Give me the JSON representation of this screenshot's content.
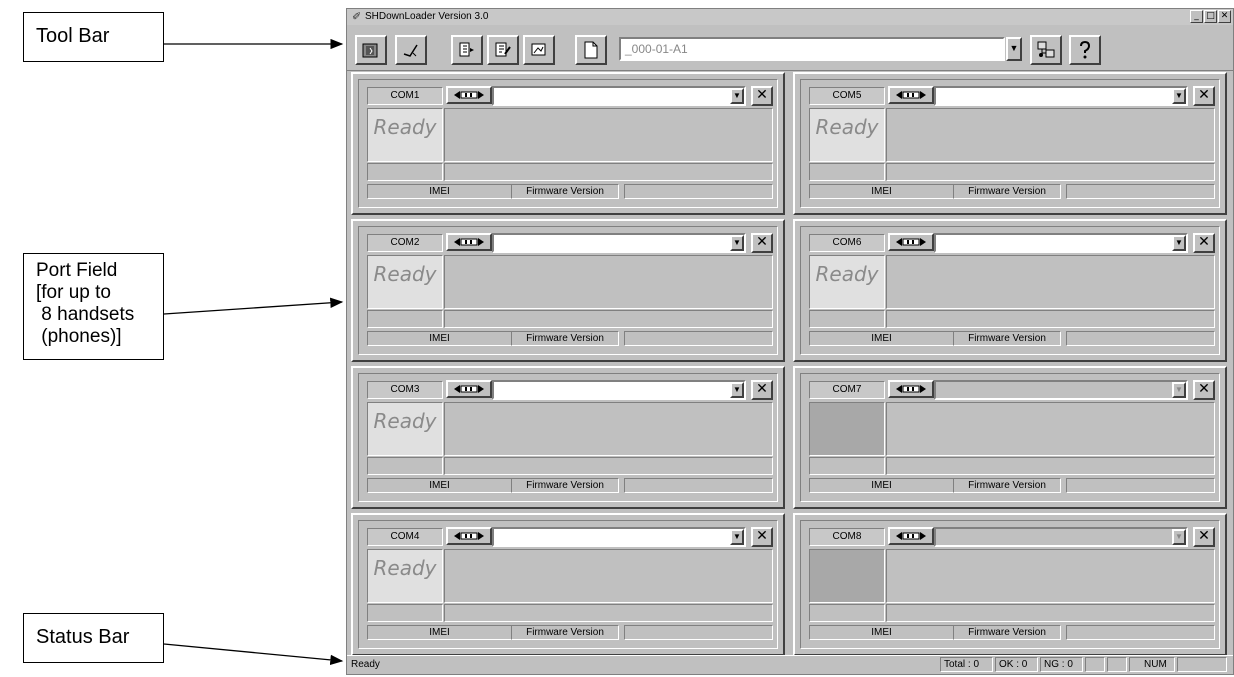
{
  "annotations": {
    "tool_bar": "Tool Bar",
    "port_field": [
      "Port Field",
      "[for up to",
      " 8 handsets",
      " (phones)]"
    ],
    "status_bar": "Status Bar"
  },
  "window": {
    "title": "SHDownLoader Version 3.0",
    "minimize": "_",
    "maximize": "□",
    "close": "✕"
  },
  "toolbar": {
    "file_path": "_000-01-A1",
    "tools": [
      "open-device-icon",
      "flash-check-icon",
      "import-icon",
      "edit-icon",
      "settings-icon",
      "new-file-icon"
    ],
    "right_tools": [
      "network-icon",
      "help-icon"
    ]
  },
  "ports": [
    {
      "name": "COM1",
      "status": "Ready",
      "imei_label": "IMEI",
      "fw_label": "Firmware Version",
      "enabled": true
    },
    {
      "name": "COM2",
      "status": "Ready",
      "imei_label": "IMEI",
      "fw_label": "Firmware Version",
      "enabled": true
    },
    {
      "name": "COM3",
      "status": "Ready",
      "imei_label": "IMEI",
      "fw_label": "Firmware Version",
      "enabled": true
    },
    {
      "name": "COM4",
      "status": "Ready",
      "imei_label": "IMEI",
      "fw_label": "Firmware Version",
      "enabled": true
    },
    {
      "name": "COM5",
      "status": "Ready",
      "imei_label": "IMEI",
      "fw_label": "Firmware Version",
      "enabled": true
    },
    {
      "name": "COM6",
      "status": "Ready",
      "imei_label": "IMEI",
      "fw_label": "Firmware Version",
      "enabled": true
    },
    {
      "name": "COM7",
      "status": "",
      "imei_label": "IMEI",
      "fw_label": "Firmware Version",
      "enabled": false
    },
    {
      "name": "COM8",
      "status": "",
      "imei_label": "IMEI",
      "fw_label": "Firmware Version",
      "enabled": false
    }
  ],
  "statusbar": {
    "text": "Ready",
    "total": "Total : 0",
    "ok": "OK : 0",
    "ng": "NG : 0",
    "num": "NUM"
  }
}
